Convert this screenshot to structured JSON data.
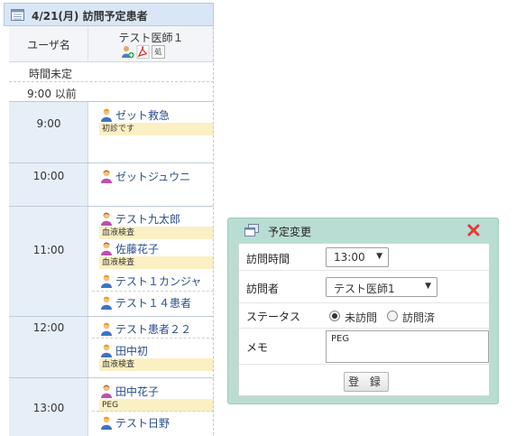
{
  "schedule": {
    "title": "4/21(月) 訪問予定患者",
    "user_column": "ユーザ名",
    "doctor_column": "テスト医師１",
    "row_undefined": "時間未定",
    "row_before": "9:00 以前",
    "hours": [
      "9:00",
      "10:00",
      "11:00",
      "12:00",
      "13:00"
    ],
    "icons": [
      "add-user-icon",
      "pdf-icon",
      "prescription-icon"
    ],
    "icon_badge": "処",
    "appointments": [
      {
        "name": "ゼット救急",
        "memo": "初診です",
        "gender": "male"
      },
      {
        "name": "ゼットジュウニ",
        "memo": "",
        "gender": "female"
      },
      {
        "name": "テスト九太郎",
        "memo": "血液検査",
        "gender": "female"
      },
      {
        "name": "佐藤花子",
        "memo": "血液検査",
        "gender": "female"
      },
      {
        "name": "テスト１カンジャ",
        "memo": "",
        "gender": "male"
      },
      {
        "name": "テスト１４患者",
        "memo": "",
        "gender": "male"
      },
      {
        "name": "テスト患者２２",
        "memo": "",
        "gender": "male"
      },
      {
        "name": "田中初",
        "memo": "血液検査",
        "gender": "male"
      },
      {
        "name": "田中花子",
        "memo": "PEG",
        "gender": "female"
      },
      {
        "name": "テスト日野",
        "memo": "",
        "gender": "male"
      }
    ]
  },
  "dialog": {
    "title": "予定変更",
    "visit_time_label": "訪問時間",
    "visit_time_value": "13:00",
    "visitor_label": "訪問者",
    "visitor_value": "テスト医師1",
    "status_label": "ステータス",
    "status_options": [
      "未訪問",
      "訪問済"
    ],
    "status_selected": "未訪問",
    "memo_label": "メモ",
    "memo_value": "PEG",
    "save_label": "登 録"
  },
  "colors": {
    "header_bg": "#d9e6f5",
    "hour_bg": "#e6eef8",
    "memo_bg": "#fbf0c3",
    "link": "#2a4e89",
    "dialog_border": "#b9ddd2",
    "male_icon": "#e79a2b",
    "female_icon": "#c04fb0",
    "close_icon": "#e53935"
  }
}
